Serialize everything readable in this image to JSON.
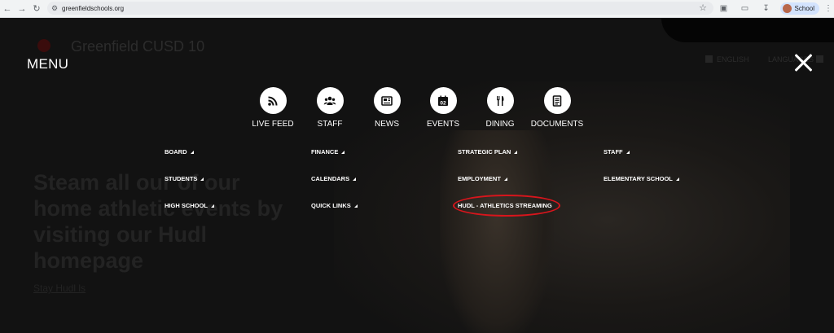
{
  "browser": {
    "url": "greenfieldschools.org",
    "profile_name": "School"
  },
  "background": {
    "site_title": "Greenfield CUSD 10",
    "util_left": "ENGLISH",
    "util_right": "LANGUAGES",
    "hero_lines": [
      "Steam all our of our",
      "home athletic events by",
      "visiting our Hudl",
      "homepage"
    ],
    "hero_link": "Stay Hudl ls"
  },
  "menu": {
    "title": "MENU",
    "quick_links": [
      {
        "label": "LIVE FEED",
        "icon": "rss-icon"
      },
      {
        "label": "STAFF",
        "icon": "people-icon"
      },
      {
        "label": "NEWS",
        "icon": "newspaper-icon"
      },
      {
        "label": "EVENTS",
        "icon": "calendar-icon",
        "day": "02"
      },
      {
        "label": "DINING",
        "icon": "fork-knife-icon"
      },
      {
        "label": "DOCUMENTS",
        "icon": "document-icon"
      }
    ],
    "links": [
      [
        "BOARD",
        "STUDENTS",
        "HIGH SCHOOL"
      ],
      [
        "FINANCE",
        "CALENDARS",
        "QUICK LINKS"
      ],
      [
        "STRATEGIC PLAN",
        "EMPLOYMENT",
        "HUDL - ATHLETICS STREAMING"
      ],
      [
        "STAFF",
        "ELEMENTARY SCHOOL"
      ]
    ]
  },
  "colors": {
    "overlay": "#0e0e0e",
    "highlight": "#d8151c"
  }
}
